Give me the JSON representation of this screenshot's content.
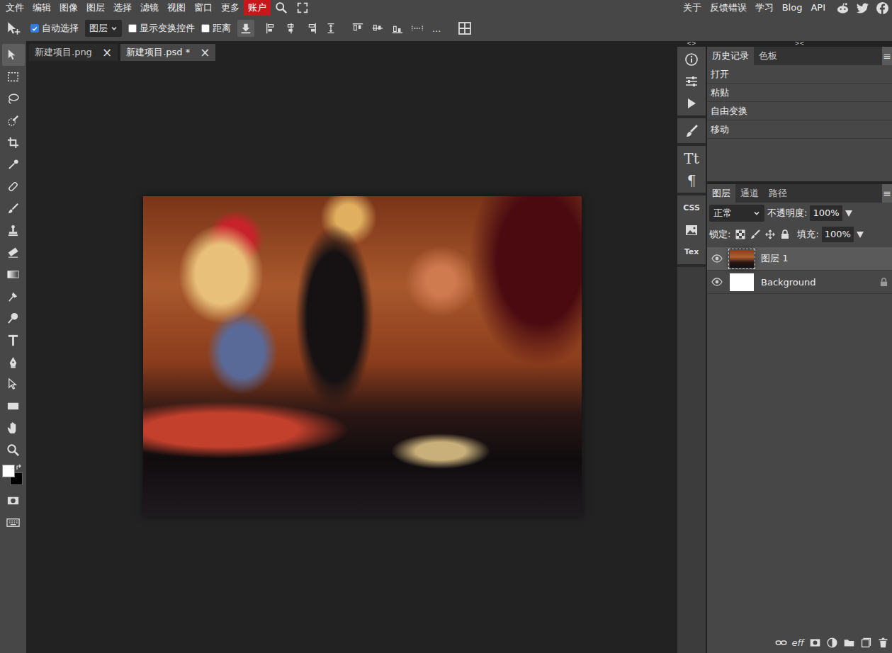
{
  "menu": [
    {
      "label": "文件",
      "accent": false
    },
    {
      "label": "编辑",
      "accent": false
    },
    {
      "label": "图像",
      "accent": false
    },
    {
      "label": "图层",
      "accent": false
    },
    {
      "label": "选择",
      "accent": false
    },
    {
      "label": "滤镜",
      "accent": false
    },
    {
      "label": "视图",
      "accent": false
    },
    {
      "label": "窗口",
      "accent": false
    },
    {
      "label": "更多",
      "accent": false
    },
    {
      "label": "账户",
      "accent": true
    }
  ],
  "top_links": [
    "关于",
    "反馈错误",
    "学习",
    "Blog",
    "API"
  ],
  "options_bar": {
    "auto_select": {
      "label": "自动选择",
      "checked": true
    },
    "target": "图层",
    "show_transform": {
      "label": "显示变换控件",
      "checked": false
    },
    "distance": {
      "label": "距离",
      "checked": false
    },
    "more": "..."
  },
  "doc_tabs": [
    {
      "label": "新建项目.png",
      "selected": false
    },
    {
      "label": "新建项目.psd *",
      "selected": true
    }
  ],
  "close_glyph": "×",
  "collapse_marks": {
    "icons": "<>",
    "panels": "><"
  },
  "tools": [
    {
      "kind": "move",
      "selected": true
    },
    {
      "kind": "marquee",
      "selected": false
    },
    {
      "kind": "lasso",
      "selected": false
    },
    {
      "kind": "quick-select",
      "selected": false
    },
    {
      "kind": "crop",
      "selected": false
    },
    {
      "kind": "eyedropper",
      "selected": false
    },
    {
      "kind": "heal",
      "selected": false
    },
    {
      "kind": "brush",
      "selected": false
    },
    {
      "kind": "stamp",
      "selected": false
    },
    {
      "kind": "eraser",
      "selected": false
    },
    {
      "kind": "gradient",
      "selected": false
    },
    {
      "kind": "smudge",
      "selected": false
    },
    {
      "kind": "dodge",
      "selected": false
    },
    {
      "kind": "type",
      "selected": false
    },
    {
      "kind": "pen",
      "selected": false
    },
    {
      "kind": "path-select",
      "selected": false
    },
    {
      "kind": "rectangle",
      "selected": false
    },
    {
      "kind": "hand",
      "selected": false
    },
    {
      "kind": "zoom",
      "selected": false
    }
  ],
  "colors": {
    "foreground": "#ffffff",
    "background": "#000000"
  },
  "side_column": [
    [
      {
        "kind": "info"
      },
      {
        "kind": "adjust"
      },
      {
        "kind": "play"
      }
    ],
    [
      {
        "kind": "brush"
      }
    ],
    [
      {
        "kind": "text",
        "label": "Tt"
      },
      {
        "kind": "text",
        "label": "¶"
      }
    ],
    [
      {
        "kind": "text",
        "label": "CSS"
      },
      {
        "kind": "image"
      },
      {
        "kind": "text",
        "label": "Tex"
      }
    ]
  ],
  "panel_menu_glyph": "≡",
  "history": {
    "tabs": [
      {
        "label": "历史记录",
        "selected": true
      },
      {
        "label": "色板",
        "selected": false
      }
    ],
    "items": [
      {
        "label": "打开",
        "selected": false
      },
      {
        "label": "粘贴",
        "selected": false
      },
      {
        "label": "自由变换",
        "selected": false
      },
      {
        "label": "移动",
        "selected": false
      }
    ]
  },
  "layers": {
    "tabs": [
      {
        "label": "图层",
        "selected": true
      },
      {
        "label": "通道",
        "selected": false
      },
      {
        "label": "路径",
        "selected": false
      }
    ],
    "blend_mode": "正常",
    "opacity_label": "不透明度:",
    "opacity": "100%",
    "lock_label": "锁定:",
    "fill_label": "填充:",
    "fill": "100%",
    "items": [
      {
        "name": "图层 1",
        "visible": true,
        "selected": true,
        "locked": false,
        "kind": "photo"
      },
      {
        "name": "Background",
        "visible": true,
        "selected": false,
        "locked": true,
        "kind": "white"
      }
    ],
    "effects_label": "eff"
  }
}
